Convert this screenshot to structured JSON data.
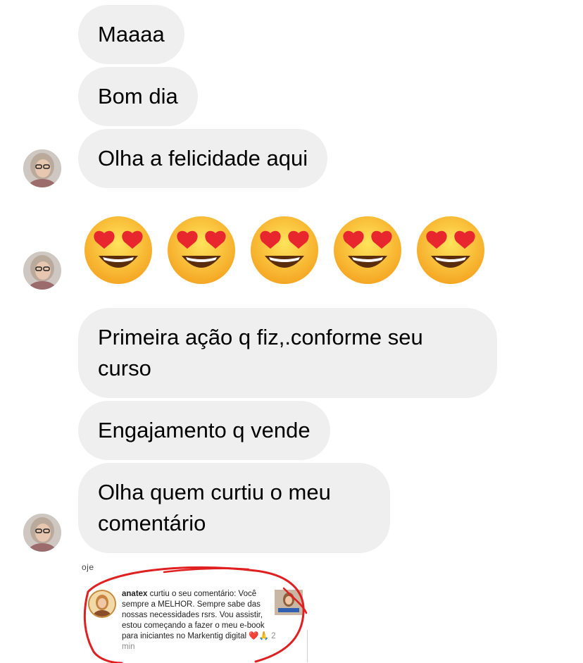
{
  "messages": [
    {
      "text": "Maaaa"
    },
    {
      "text": "Bom dia"
    },
    {
      "text": "Olha a felicidade aqui"
    },
    {
      "emoji": "smiling-face-with-heart-eyes",
      "count": 5
    },
    {
      "text": "Primeira ação q fiz,.conforme seu curso"
    },
    {
      "text": "Engajamento q vende"
    },
    {
      "text": "Olha quem curtiu o meu comentário"
    }
  ],
  "attached_screenshot": {
    "cut_text": "oje",
    "username": "anatex",
    "notification": "curtiu o seu comentário: Você sempre a MELHOR. Sempre sabe das nossas necessidades rsrs. Vou assistir, estou começando a fazer o meu e-book para iniciantes no Markentig digital",
    "emojis": "❤️🙏",
    "time": "2 min"
  },
  "colors": {
    "bubble": "#efefef",
    "annotation_stroke": "#e02020"
  }
}
